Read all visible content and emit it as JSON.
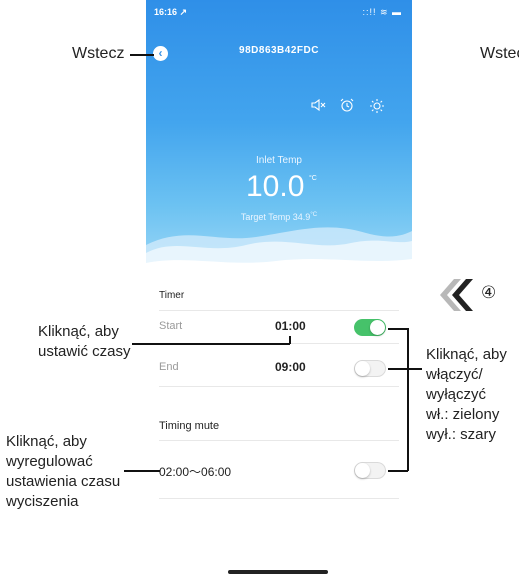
{
  "status": {
    "time": "16:16 ↗",
    "icons": "::!! ≋ ▬"
  },
  "header": {
    "device_id": "98D863B42FDC",
    "back_glyph": "‹"
  },
  "icons": {
    "mute": "mute-icon",
    "alarm": "alarm-icon",
    "brightness": "sun-icon"
  },
  "temperature": {
    "inlet_label": "Inlet Temp",
    "inlet_value": "10.0",
    "unit": "°C",
    "target_label": "Target Temp",
    "target_value": "34.9",
    "target_unit": "°C"
  },
  "timer": {
    "title": "Timer",
    "start_label": "Start",
    "start_time": "01:00",
    "start_enabled": true,
    "end_label": "End",
    "end_time": "09:00",
    "end_enabled": false
  },
  "timing_mute": {
    "title": "Timing mute",
    "range": "02:00～06:00",
    "enabled": false
  },
  "annotations": {
    "back": "Wstecz",
    "back_right": "Wstec",
    "set_times": [
      "Kliknąć, aby",
      "ustawić czasy"
    ],
    "toggle_info": [
      "Kliknąć, aby",
      "włączyć/",
      "wyłączyć",
      "wł.: zielony",
      "wył.: szary"
    ],
    "adjust_mute": [
      "Kliknąć, aby",
      "wyregulować",
      "ustawienia czasu",
      "wyciszenia"
    ],
    "step_number": "④"
  },
  "colors": {
    "accent_green": "#46c26a",
    "header_blue": "#2f8fe8"
  }
}
